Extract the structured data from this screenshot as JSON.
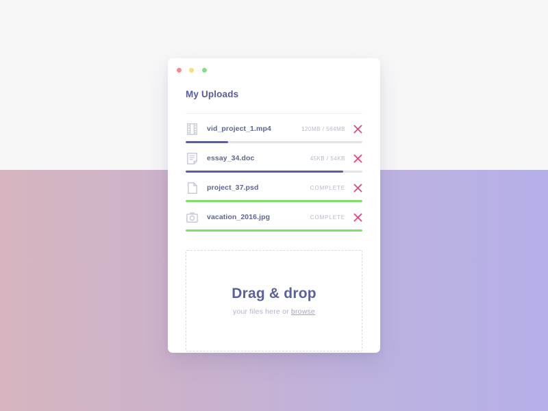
{
  "window": {
    "traffic_lights": [
      {
        "name": "close-dot",
        "color": "#f98a8a"
      },
      {
        "name": "minimize-dot",
        "color": "#f7dd79"
      },
      {
        "name": "maximize-dot",
        "color": "#85e085"
      }
    ]
  },
  "header": {
    "title": "My Uploads"
  },
  "colors": {
    "accent_purple": "#5b5ba5",
    "accent_green": "#7ee06a",
    "remove_pink": "#e8437c",
    "title_text": "#575b9c",
    "muted_text": "#b6b8c9",
    "bg_top": "#f7f7f8",
    "bg_gradient_left": "#d6b5bf",
    "bg_gradient_right": "#b5b0e9"
  },
  "files": [
    {
      "icon": "film-strip-icon",
      "name": "vid_project_1.mp4",
      "status": "120MB / 564MB",
      "status_kind": "uploading",
      "progress_percent": 24,
      "remove_label": "✕"
    },
    {
      "icon": "document-icon",
      "name": "essay_34.doc",
      "status": "45KB / 54KB",
      "status_kind": "uploading",
      "progress_percent": 89,
      "remove_label": "✕"
    },
    {
      "icon": "file-icon",
      "name": "project_37.psd",
      "status": "COMPLETE",
      "status_kind": "complete",
      "progress_percent": 100,
      "remove_label": "✕"
    },
    {
      "icon": "camera-icon",
      "name": "vacation_2016.jpg",
      "status": "COMPLETE",
      "status_kind": "complete",
      "progress_percent": 100,
      "remove_label": "✕"
    }
  ],
  "dropzone": {
    "title": "Drag & drop",
    "subtitle_prefix": "your files here or ",
    "browse_label": "browse"
  }
}
